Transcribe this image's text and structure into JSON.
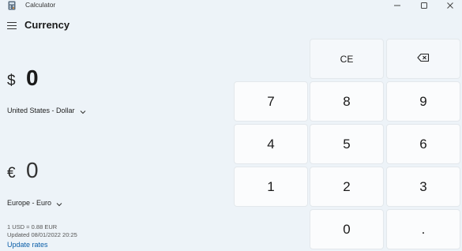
{
  "window": {
    "title": "Calculator"
  },
  "header": {
    "mode": "Currency"
  },
  "from": {
    "symbol": "$",
    "amount": "0",
    "currency": "United States - Dollar"
  },
  "to": {
    "symbol": "€",
    "amount": "0",
    "currency": "Europe - Euro"
  },
  "rate": {
    "line1": "1 USD = 0.88 EUR",
    "line2": "Updated 08/01/2022 20:25",
    "update_link": "Update rates"
  },
  "keypad": {
    "ce": "CE",
    "k7": "7",
    "k8": "8",
    "k9": "9",
    "k4": "4",
    "k5": "5",
    "k6": "6",
    "k1": "1",
    "k2": "2",
    "k3": "3",
    "k0": "0",
    "dot": "."
  },
  "icons": {
    "backspace": "backspace-icon",
    "menu": "hamburger-icon",
    "chevron": "chevron-down-icon"
  },
  "colors": {
    "link": "#0a5ea8",
    "background": "#edf3f8"
  }
}
